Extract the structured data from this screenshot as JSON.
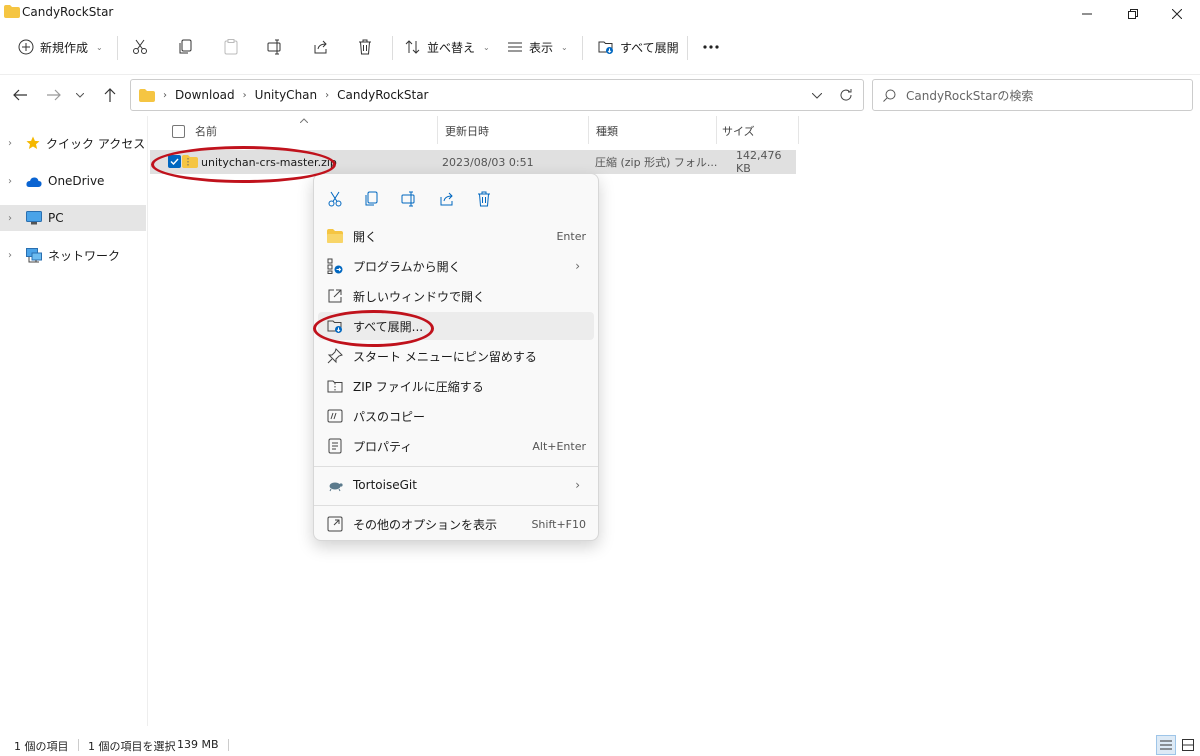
{
  "window": {
    "title": "CandyRockStar",
    "icons": [
      "folder-icon",
      "minimize-icon",
      "restore-icon",
      "close-icon"
    ]
  },
  "toolbar": {
    "new_label": "新規作成",
    "sort_label": "並べ替え",
    "view_label": "表示",
    "extract_all_label": "すべて展開",
    "icons": [
      "plus-circle-icon",
      "cut-icon",
      "copy-icon",
      "paste-icon",
      "rename-icon",
      "share-icon",
      "delete-icon",
      "sort-icon",
      "view-icon",
      "extract-icon",
      "more-icon"
    ]
  },
  "address": {
    "crumbs": [
      "Download",
      "UnityChan",
      "CandyRockStar"
    ],
    "search_placeholder": "CandyRockStarの検索"
  },
  "sidebar": {
    "items": [
      {
        "label": "クイック アクセス",
        "icon": "star-icon"
      },
      {
        "label": "OneDrive",
        "icon": "cloud-icon"
      },
      {
        "label": "PC",
        "icon": "pc-icon"
      },
      {
        "label": "ネットワーク",
        "icon": "network-icon"
      }
    ]
  },
  "list": {
    "columns": [
      "名前",
      "更新日時",
      "種類",
      "サイズ"
    ],
    "rows": [
      {
        "name": "unitychan-crs-master.zip",
        "modified": "2023/08/03 0:51",
        "type": "圧縮 (zip 形式) フォル...",
        "size": "142,476 KB"
      }
    ]
  },
  "context_menu": {
    "items": [
      {
        "label": "開く",
        "shortcut": "Enter",
        "icon": "folder-icon"
      },
      {
        "label": "プログラムから開く",
        "icon": "open-with-icon"
      },
      {
        "label": "新しいウィンドウで開く",
        "icon": "new-window-icon"
      },
      {
        "label": "すべて展開...",
        "icon": "extract-icon"
      },
      {
        "label": "スタート メニューにピン留めする",
        "icon": "pin-icon"
      },
      {
        "label": "ZIP ファイルに圧縮する",
        "icon": "zip-icon"
      },
      {
        "label": "パスのコピー",
        "icon": "copy-path-icon"
      },
      {
        "label": "プロパティ",
        "shortcut": "Alt+Enter",
        "icon": "properties-icon"
      },
      {
        "label": "TortoiseGit",
        "icon": "tortoise-icon"
      },
      {
        "label": "その他のオプションを表示",
        "shortcut": "Shift+F10",
        "icon": "more-options-icon"
      }
    ]
  },
  "status": {
    "items_count": "1 個の項目",
    "selected": "1 個の項目を選択",
    "size": "139 MB"
  },
  "colors": {
    "accent": "#0067c0",
    "folder": "#f5c542",
    "annotation": "#c0121c"
  }
}
